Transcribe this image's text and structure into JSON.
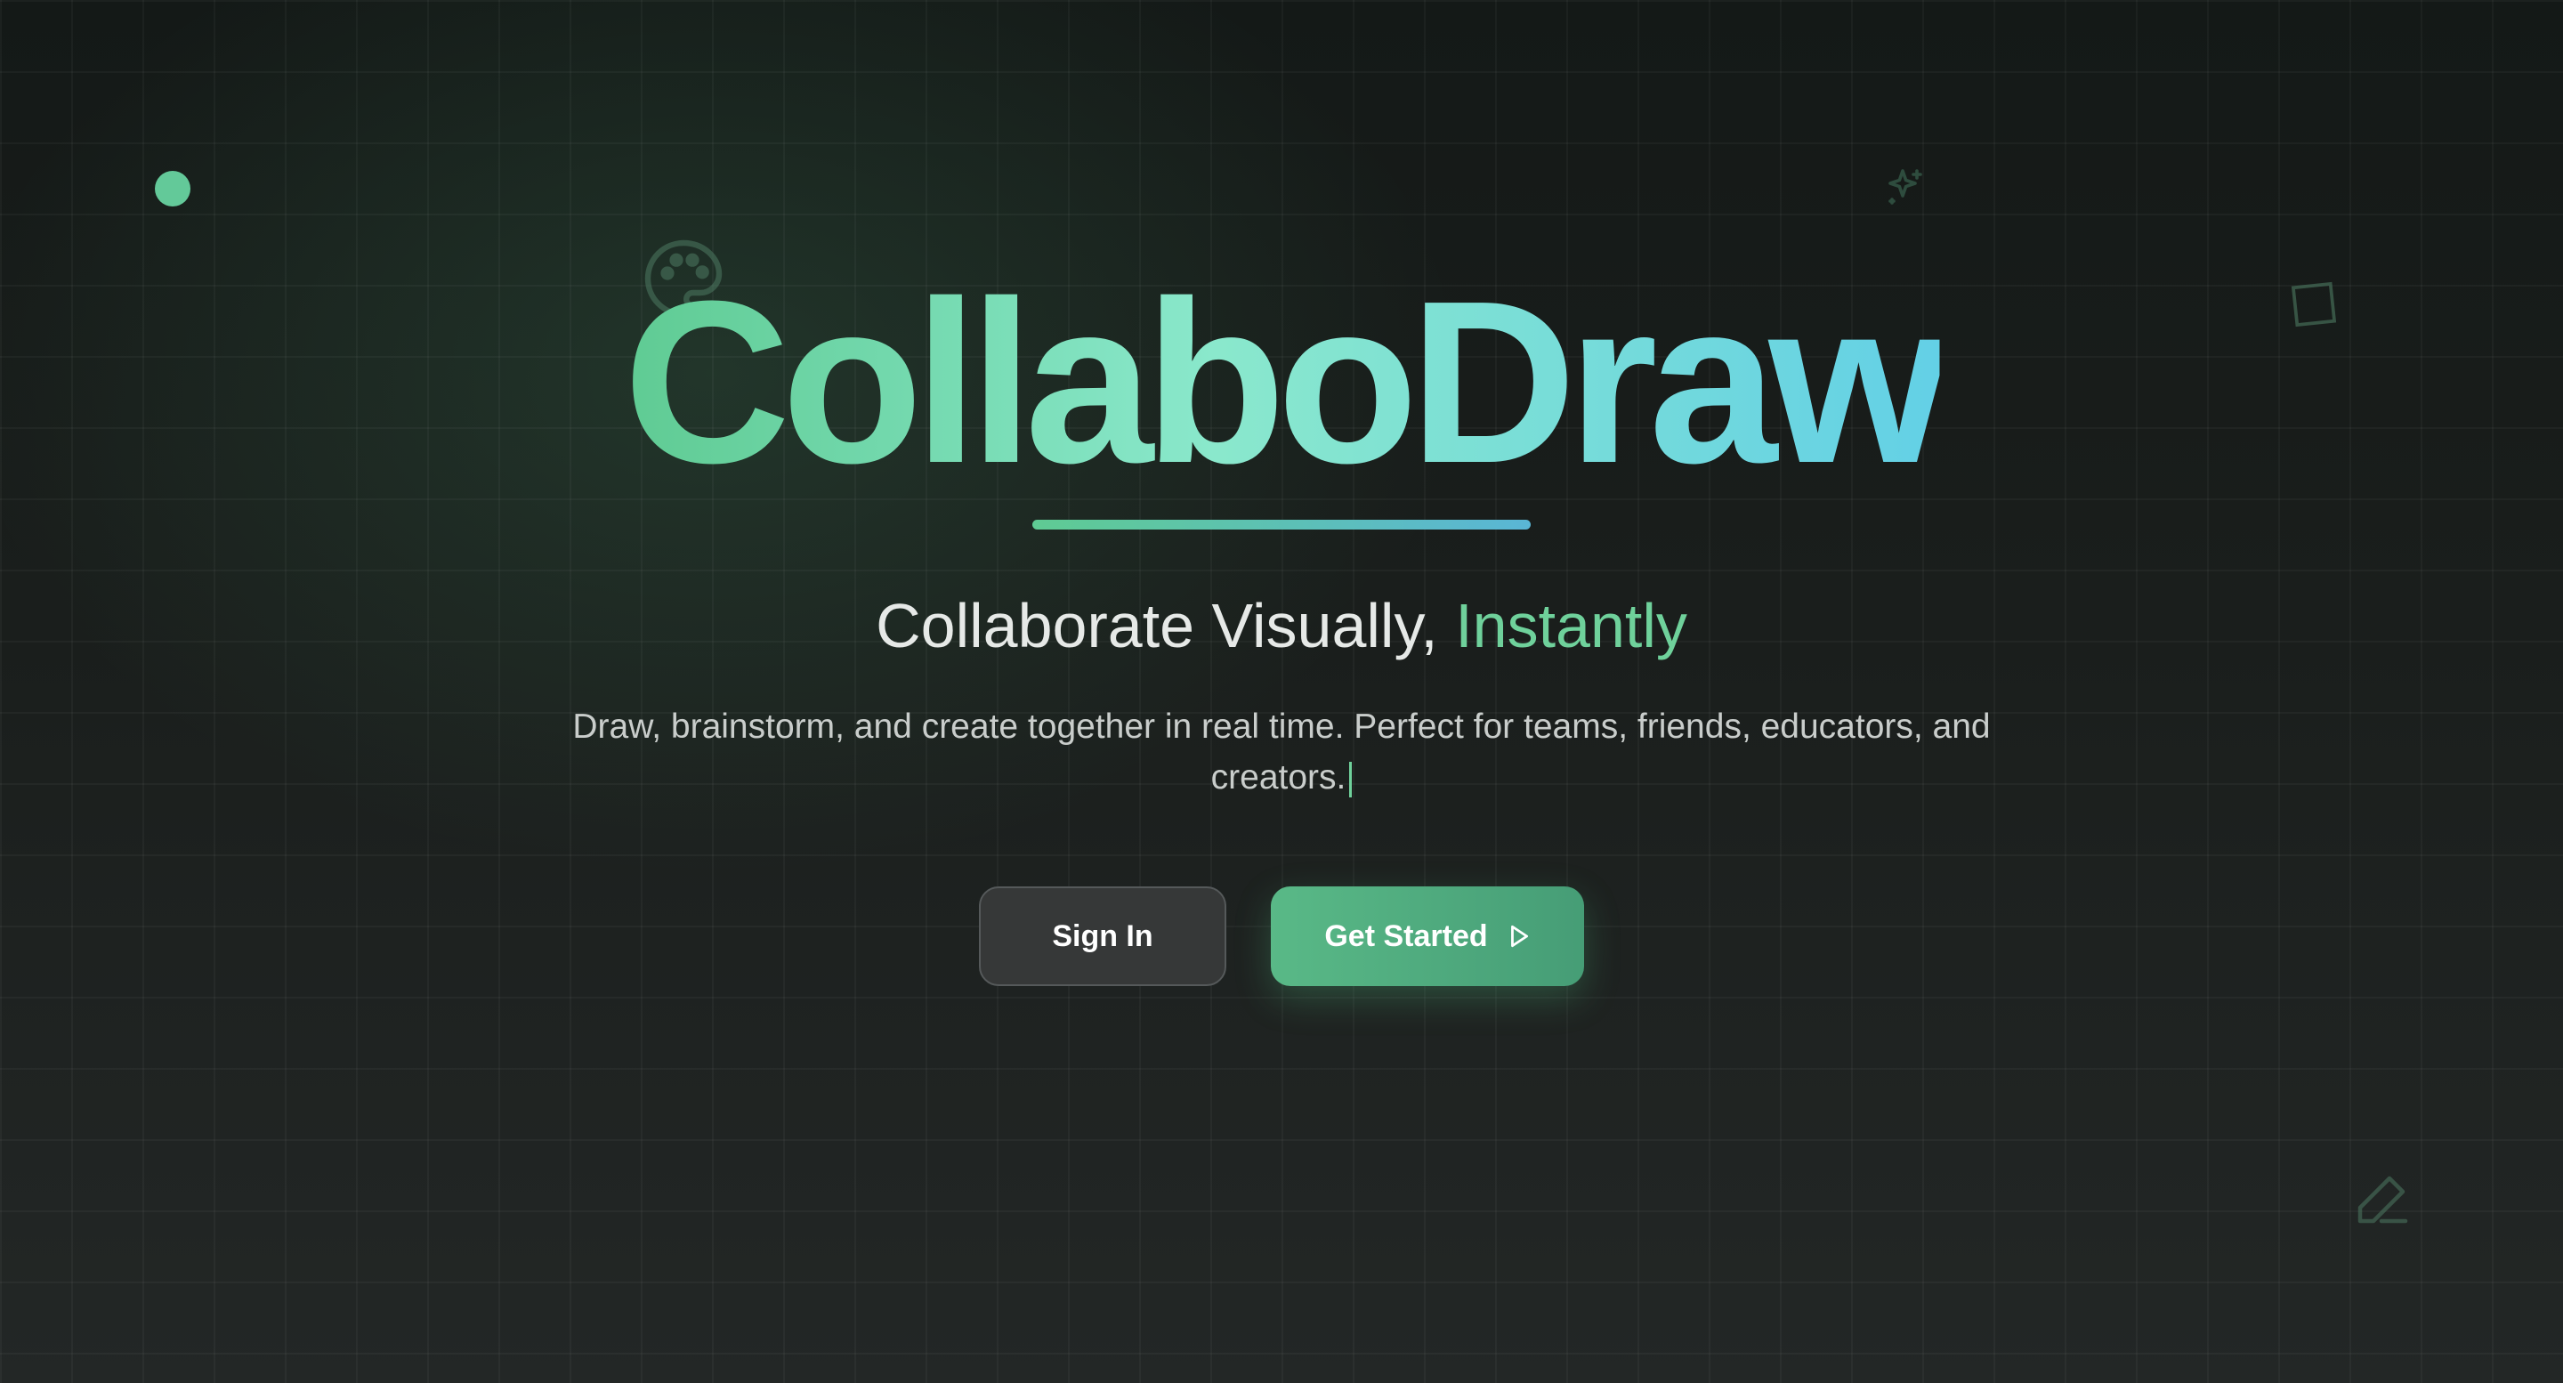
{
  "brand": {
    "name": "CollaboDraw",
    "gradient_start": "#5fcb93",
    "gradient_end": "#63d0e6"
  },
  "hero": {
    "tagline_main": "Collaborate Visually,",
    "tagline_accent": "Instantly",
    "description": "Draw, brainstorm, and create together in real time. Perfect for teams, friends, educators, and creators."
  },
  "actions": {
    "sign_in_label": "Sign In",
    "get_started_label": "Get Started"
  },
  "decorations": {
    "icons": [
      "dot",
      "palette-icon",
      "sparkle-icon",
      "square-outline",
      "pencil-icon"
    ]
  },
  "colors": {
    "accent": "#6fd19b",
    "background": "#1b1e1d",
    "button_secondary": "#363838"
  }
}
